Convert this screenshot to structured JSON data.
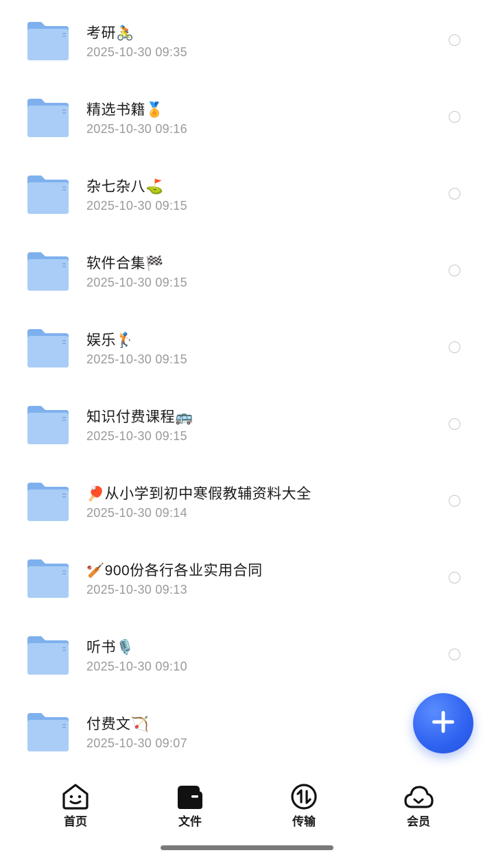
{
  "files": [
    {
      "name": "考研🚴",
      "date": "2025-10-30 09:35"
    },
    {
      "name": "精选书籍🏅",
      "date": "2025-10-30 09:16"
    },
    {
      "name": "杂七杂八⛳",
      "date": "2025-10-30 09:15"
    },
    {
      "name": "软件合集🏁",
      "date": "2025-10-30 09:15"
    },
    {
      "name": "娱乐🏌",
      "date": "2025-10-30 09:15"
    },
    {
      "name": "知识付费课程🚌",
      "date": "2025-10-30 09:15"
    },
    {
      "name": "🏓从小学到初中寒假教辅资料大全",
      "date": "2025-10-30 09:14"
    },
    {
      "name": "🏏900份各行各业实用合同",
      "date": "2025-10-30 09:13"
    },
    {
      "name": "听书🎙️",
      "date": "2025-10-30 09:10"
    },
    {
      "name": "付费文🏹",
      "date": "2025-10-30 09:07"
    }
  ],
  "fab": {
    "icon": "plus-icon"
  },
  "tabbar": {
    "tabs": [
      {
        "label": "首页",
        "icon": "home-face-icon"
      },
      {
        "label": "文件",
        "icon": "wallet-folder-icon"
      },
      {
        "label": "传输",
        "icon": "transfer-arrows-icon"
      },
      {
        "label": "会员",
        "icon": "cloud-icon"
      }
    ]
  },
  "colors": {
    "accent": "#2f62f0",
    "folder": "#8fbaf2",
    "secondary_text": "#9a9a9a"
  }
}
